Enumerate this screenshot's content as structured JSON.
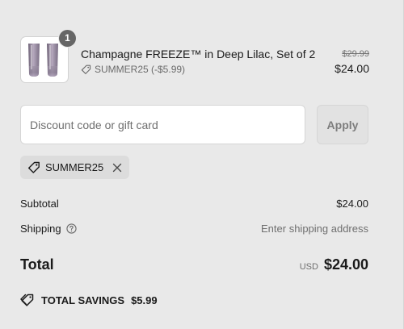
{
  "line_item": {
    "quantity": "1",
    "title": "Champagne FREEZE™ in Deep Lilac, Set of 2",
    "discount_code_label": "SUMMER25 (-$5.99)",
    "original_price": "$29.99",
    "current_price": "$24.00",
    "image_icon": "lilac-glasses-image"
  },
  "discount": {
    "placeholder": "Discount code or gift card",
    "value": "",
    "apply_label": "Apply"
  },
  "applied_code": {
    "code": "SUMMER25"
  },
  "summary": {
    "subtotal_label": "Subtotal",
    "subtotal_value": "$24.00",
    "shipping_label": "Shipping",
    "shipping_value": "Enter shipping address",
    "total_label": "Total",
    "currency": "USD",
    "total_value": "$24.00",
    "savings_label": "TOTAL SAVINGS",
    "savings_value": "$5.99"
  },
  "colors": {
    "background": "#e9e9e9",
    "badge": "#666666",
    "muted_text": "#6f6f6f",
    "product_lilac": "#8d7f96"
  }
}
